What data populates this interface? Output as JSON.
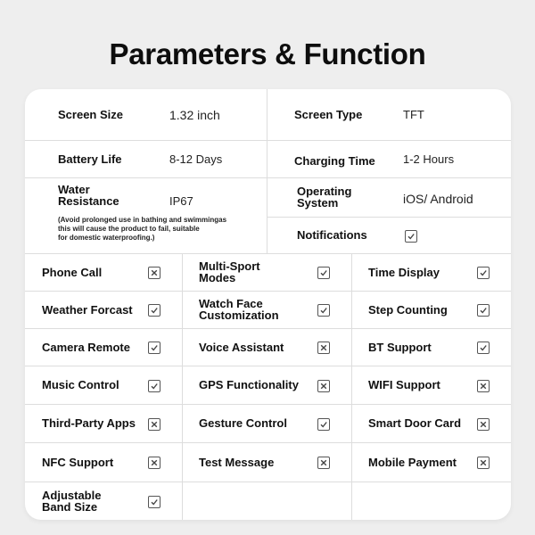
{
  "title": "Parameters & Function",
  "parameters": {
    "screen_size": {
      "label": "Screen Size",
      "value": "1.32 inch"
    },
    "screen_type": {
      "label": "Screen Type",
      "value": "TFT"
    },
    "battery_life": {
      "label": "Battery Life",
      "value": "8-12 Days"
    },
    "charging_time": {
      "label": "Charging Time",
      "value": "1-2 Hours"
    },
    "water_resistance": {
      "label_line1": "Water",
      "label_line2": "Resistance",
      "value": "IP67",
      "note_line1": "(Avoid prolonged use in bathing and swimmingas",
      "note_line2": "this will cause the product to fail, suitable",
      "note_line3": "for domestic waterproofing.)"
    },
    "operating_system": {
      "label_line1": "Operating",
      "label_line2": "System",
      "value": "iOS/ Android"
    },
    "notifications": {
      "label": "Notifications",
      "status": "check"
    }
  },
  "features": [
    [
      {
        "line1": "Phone Call",
        "line2": "",
        "status": "cross"
      },
      {
        "line1": "Multi-Sport",
        "line2": "Modes",
        "status": "check"
      },
      {
        "line1": "Time Display",
        "line2": "",
        "status": "check"
      }
    ],
    [
      {
        "line1": "Weather Forcast",
        "line2": "",
        "status": "check"
      },
      {
        "line1": "Watch Face",
        "line2": "Customization",
        "status": "check"
      },
      {
        "line1": "Step Counting",
        "line2": "",
        "status": "check"
      }
    ],
    [
      {
        "line1": "Camera Remote",
        "line2": "",
        "status": "check"
      },
      {
        "line1": "Voice Assistant",
        "line2": "",
        "status": "cross"
      },
      {
        "line1": "BT Support",
        "line2": "",
        "status": "check"
      }
    ],
    [
      {
        "line1": "Music Control",
        "line2": "",
        "status": "check"
      },
      {
        "line1": "GPS Functionality",
        "line2": "",
        "status": "cross"
      },
      {
        "line1": "WIFI Support",
        "line2": "",
        "status": "cross"
      }
    ],
    [
      {
        "line1": "Third-Party Apps",
        "line2": "",
        "status": "cross"
      },
      {
        "line1": "Gesture Control",
        "line2": "",
        "status": "check"
      },
      {
        "line1": "Smart Door Card",
        "line2": "",
        "status": "cross"
      }
    ],
    [
      {
        "line1": "NFC Support",
        "line2": "",
        "status": "cross"
      },
      {
        "line1": "Test Message",
        "line2": "",
        "status": "cross"
      },
      {
        "line1": "Mobile Payment",
        "line2": "",
        "status": "cross"
      }
    ],
    [
      {
        "line1": "Adjustable",
        "line2": "Band Size",
        "status": "check"
      },
      null,
      null
    ]
  ],
  "icons": {
    "check": "check-icon",
    "cross": "cross-icon"
  },
  "colors": {
    "background": "#eeeeee",
    "card": "#ffffff",
    "divider": "#dddddd",
    "checkbox_border": "#555555"
  }
}
